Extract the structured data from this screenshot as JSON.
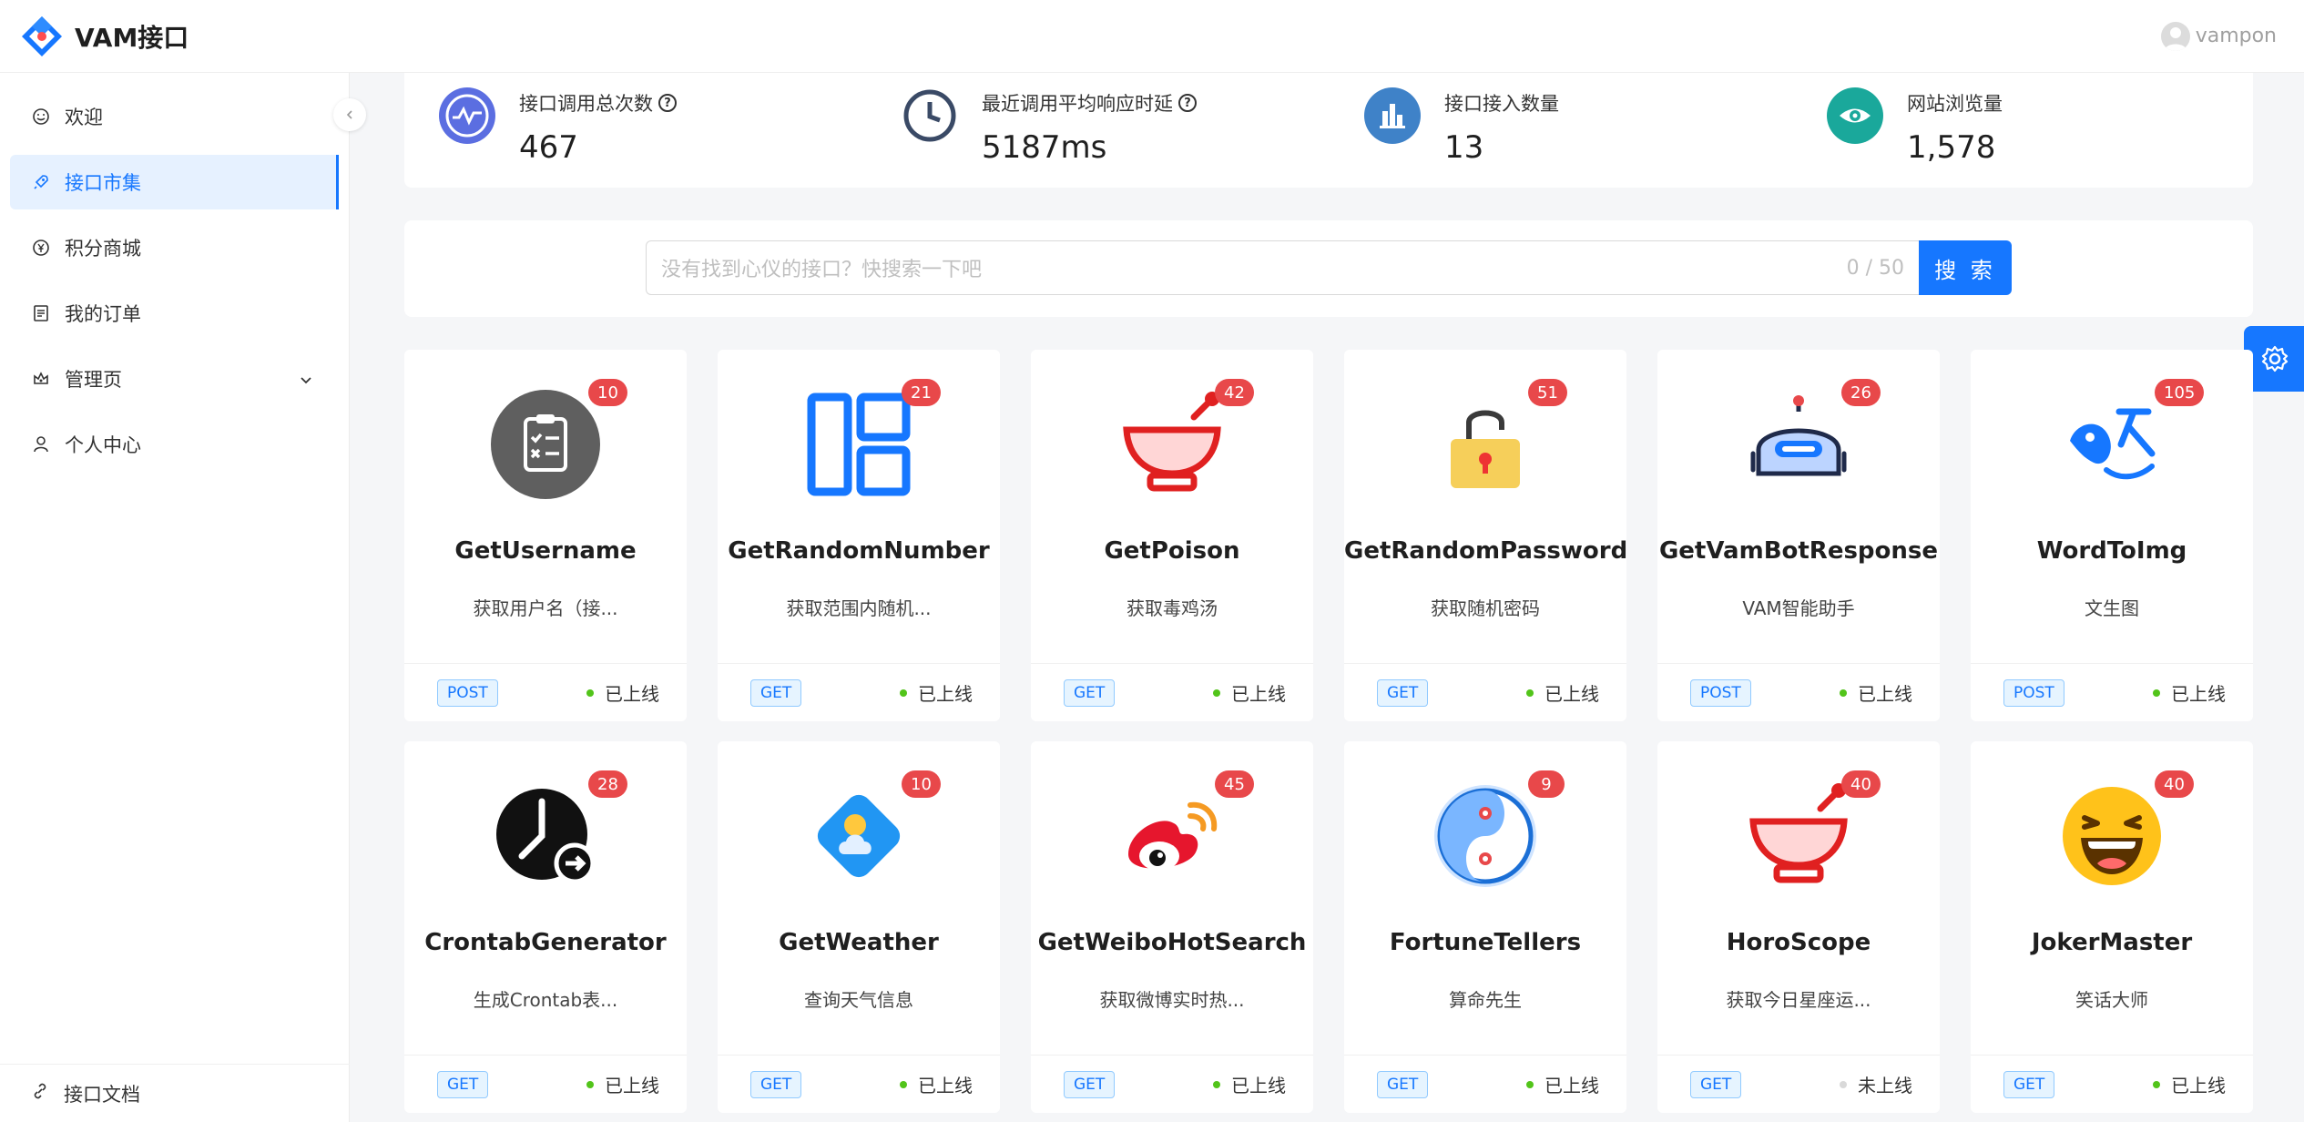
{
  "app": {
    "title": "VAM接口",
    "user": "vampon"
  },
  "colors": {
    "primary": "#1677ff",
    "badge": "#e8484a",
    "online": "#52c41a",
    "offline": "#d9d9d9"
  },
  "sidebar": {
    "items": [
      {
        "label": "欢迎",
        "icon": "smile-icon"
      },
      {
        "label": "接口市集",
        "icon": "rocket-icon",
        "active": true
      },
      {
        "label": "积分商城",
        "icon": "yen-icon"
      },
      {
        "label": "我的订单",
        "icon": "order-icon"
      },
      {
        "label": "管理页",
        "icon": "crown-icon"
      },
      {
        "label": "个人中心",
        "icon": "user-icon"
      }
    ],
    "doc_link": "接口文档"
  },
  "stats": [
    {
      "label": "接口调用总次数",
      "value": "467",
      "icon": "wave-icon",
      "color": "#5b6ee1"
    },
    {
      "label": "最近调用平均响应时延",
      "value": "5187ms",
      "icon": "clock-icon",
      "color": "#3a4a66"
    },
    {
      "label": "接口接入数量",
      "value": "13",
      "icon": "bar-chart-icon",
      "color": "#3f82c8"
    },
    {
      "label": "网站浏览量",
      "value": "1,578",
      "icon": "eye-icon",
      "color": "#1aa89b"
    }
  ],
  "search": {
    "placeholder": "没有找到心仪的接口？快搜索一下吧",
    "count": "0 / 50",
    "button": "搜 索"
  },
  "cards": [
    {
      "name": "GetUsername",
      "desc": "获取用户名（接...",
      "method": "POST",
      "status": "已上线",
      "count": "10",
      "icon": "clipboard-icon"
    },
    {
      "name": "GetRandomNumber",
      "desc": "获取范围内随机...",
      "method": "GET",
      "status": "已上线",
      "count": "21",
      "icon": "layout-icon"
    },
    {
      "name": "GetPoison",
      "desc": "获取毒鸡汤",
      "method": "GET",
      "status": "已上线",
      "count": "42",
      "icon": "soup-bowl-icon"
    },
    {
      "name": "GetRandomPassword",
      "desc": "获取随机密码",
      "method": "GET",
      "status": "已上线",
      "count": "51",
      "icon": "lock-icon"
    },
    {
      "name": "GetVamBotResponse",
      "desc": "VAM智能助手",
      "method": "POST",
      "status": "已上线",
      "count": "26",
      "icon": "robot-icon"
    },
    {
      "name": "WordToImg",
      "desc": "文生图",
      "method": "POST",
      "status": "已上线",
      "count": "105",
      "icon": "text-image-icon"
    },
    {
      "name": "CrontabGenerator",
      "desc": "生成Crontab表...",
      "method": "GET",
      "status": "已上线",
      "count": "28",
      "icon": "clock-arrow-icon"
    },
    {
      "name": "GetWeather",
      "desc": "查询天气信息",
      "method": "GET",
      "status": "已上线",
      "count": "10",
      "icon": "weather-icon"
    },
    {
      "name": "GetWeiboHotSearch",
      "desc": "获取微博实时热...",
      "method": "GET",
      "status": "已上线",
      "count": "45",
      "icon": "weibo-icon"
    },
    {
      "name": "FortuneTellers",
      "desc": "算命先生",
      "method": "GET",
      "status": "已上线",
      "count": "9",
      "icon": "yin-yang-icon"
    },
    {
      "name": "HoroScope",
      "desc": "获取今日星座运...",
      "method": "GET",
      "status": "未上线",
      "count": "40",
      "icon": "soup-bowl-icon"
    },
    {
      "name": "JokerMaster",
      "desc": "笑话大师",
      "method": "GET",
      "status": "已上线",
      "count": "40",
      "icon": "laughing-face-icon"
    }
  ]
}
